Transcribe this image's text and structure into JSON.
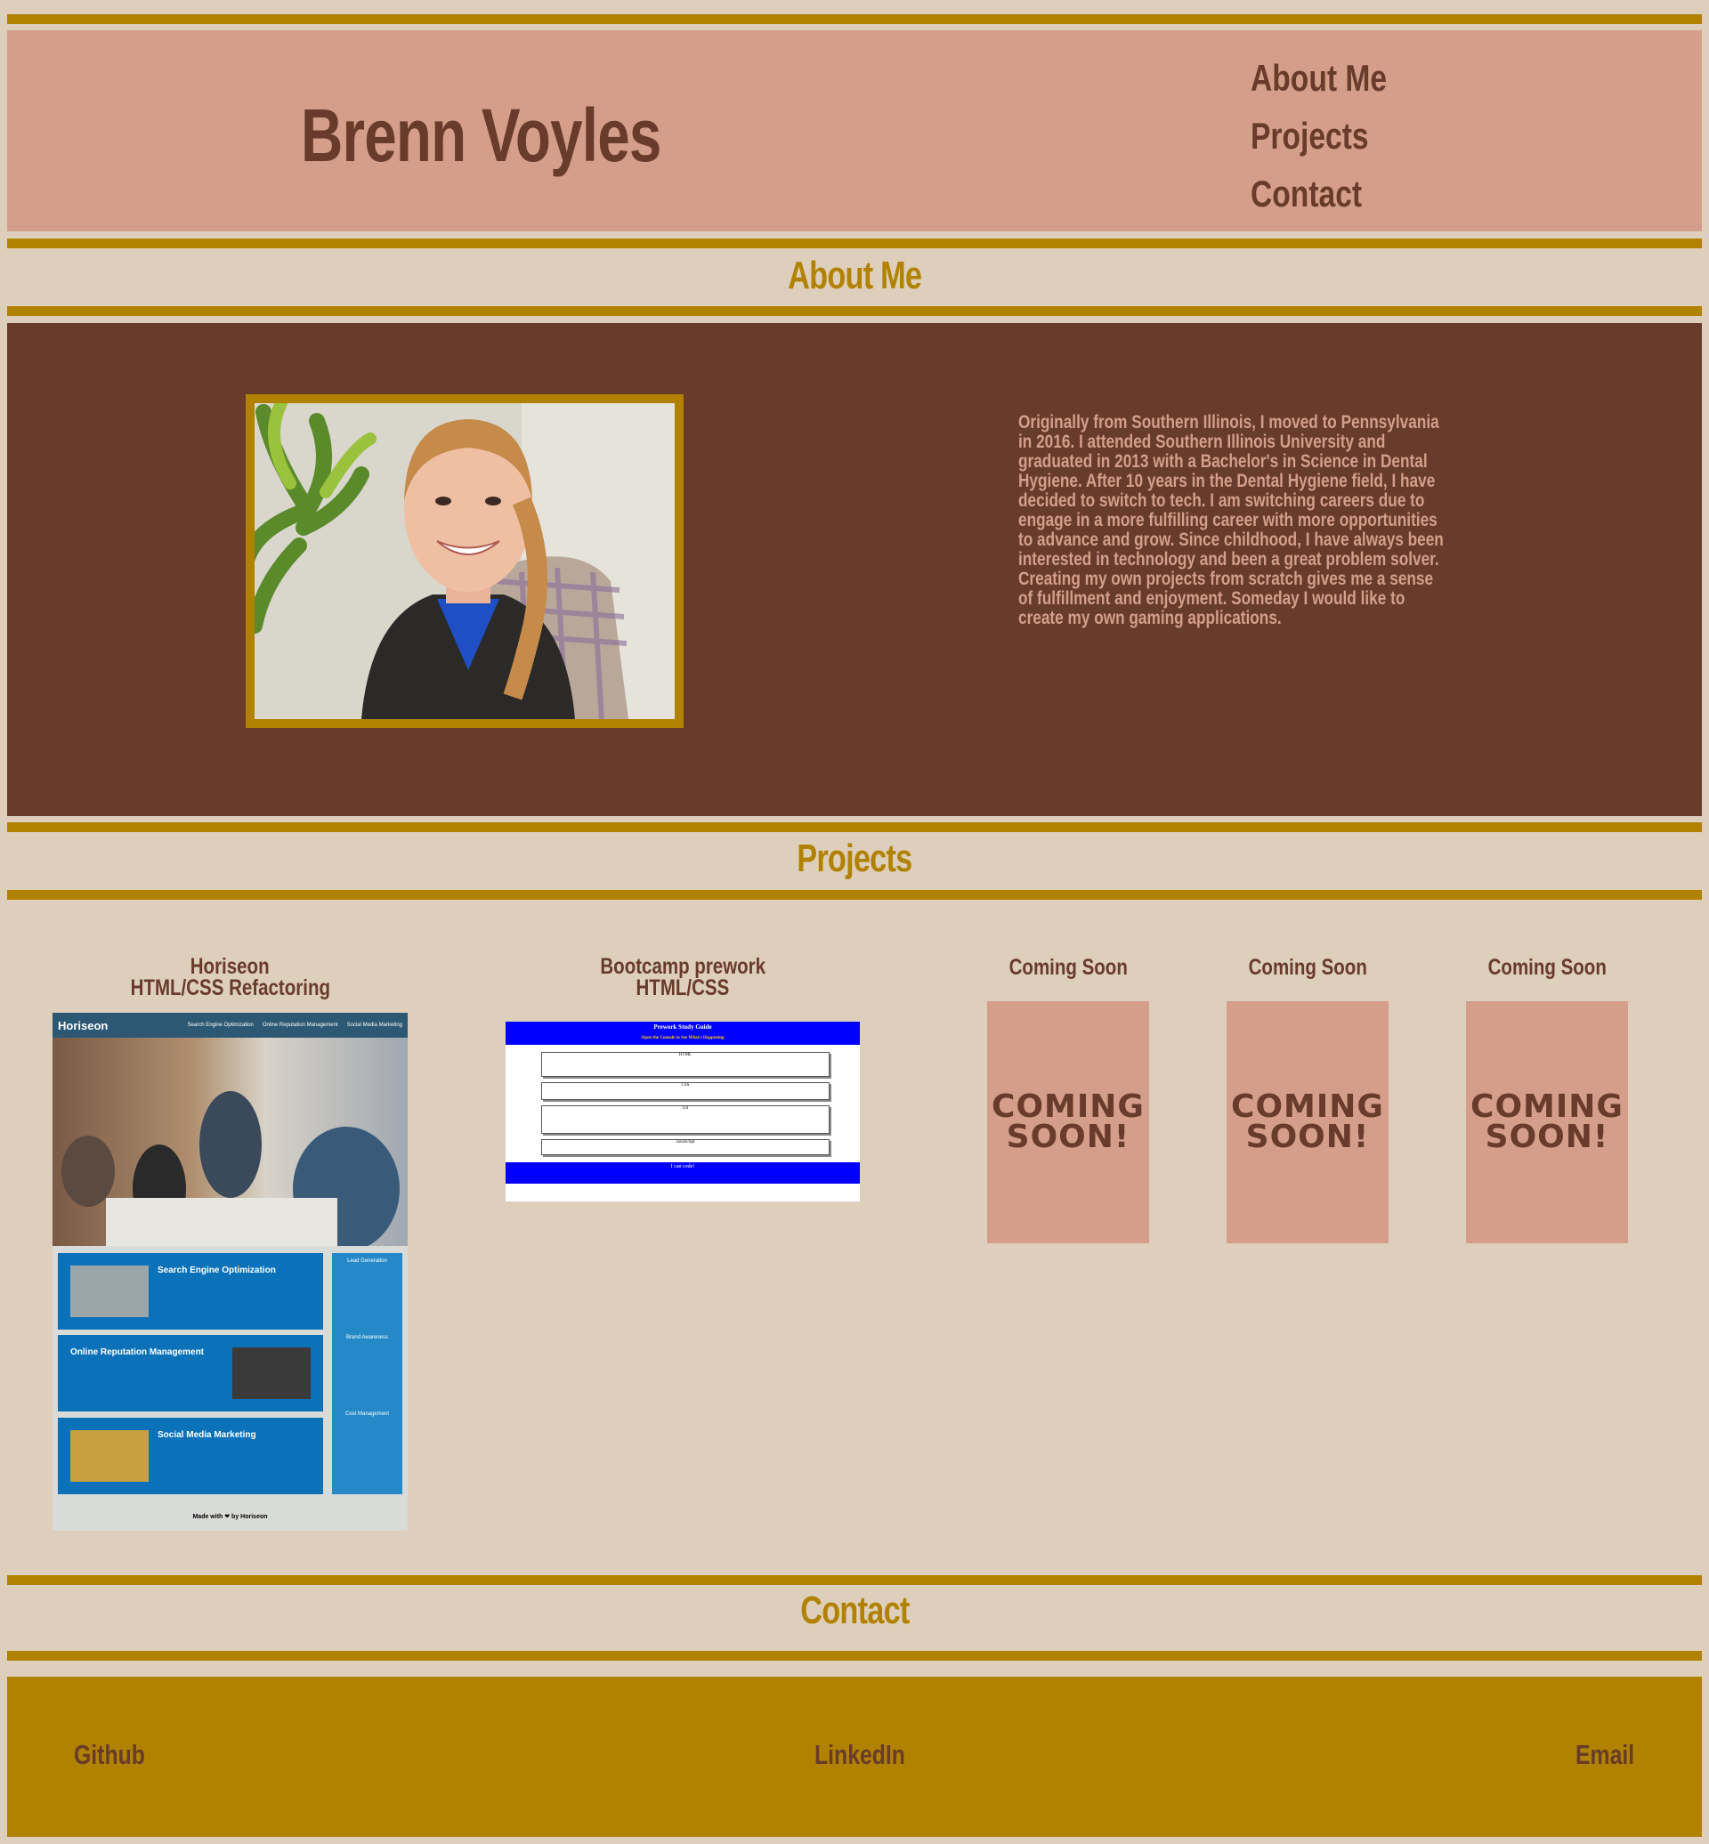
{
  "header": {
    "title": "Brenn Voyles",
    "nav": [
      "About Me",
      "Projects",
      "Contact"
    ]
  },
  "sections": {
    "about_title": "About Me",
    "projects_title": "Projects",
    "contact_title": "Contact"
  },
  "about": {
    "bio": "Originally from Southern Illinois, I moved to Pennsylvania in 2016. I attended Southern Illinois University and graduated in 2013 with a Bachelor's in Science in Dental Hygiene. After 10 years in the Dental Hygiene field, I have decided to switch to tech. I am switching careers due to engage in a more fulfilling career with more opportunities to advance and grow. Since childhood, I have always been interested in technology and been a great problem solver. Creating my own projects from scratch gives me a sense of fulfillment and enjoyment. Someday I would like to create my own gaming applications."
  },
  "projects": [
    {
      "title_line1": "Horiseon",
      "title_line2": "HTML/CSS Refactoring"
    },
    {
      "title_line1": "Bootcamp prework",
      "title_line2": "HTML/CSS"
    },
    {
      "title": "Coming Soon",
      "card_text": "COMING SOON!"
    },
    {
      "title": "Coming Soon",
      "card_text": "COMING SOON!"
    },
    {
      "title": "Coming Soon",
      "card_text": "COMING SOON!"
    }
  ],
  "horiseon_thumb": {
    "brand": "Horiseon",
    "nav": [
      "Search Engine Optimization",
      "Online Reputation Management",
      "Social Media Marketing"
    ],
    "cards": [
      "Search Engine Optimization",
      "Online Reputation Management",
      "Social Media Marketing"
    ],
    "side": [
      "Lead Generation",
      "Brand Awareness",
      "Cost Management"
    ],
    "footer": "Made with ❤ by Horiseon"
  },
  "prework_thumb": {
    "title": "Prework Study Guide",
    "subtitle": "Open the Console to See What's Happening",
    "sections": [
      "HTML",
      "CSS",
      "Git",
      "JavaScript"
    ],
    "footer": "I can code!"
  },
  "contact": {
    "links": [
      "Github",
      "LinkedIn",
      "Email"
    ]
  },
  "colors": {
    "background": "#decfbc",
    "gold": "#b18200",
    "brown": "#683b2b",
    "rose": "#d49e8a"
  }
}
